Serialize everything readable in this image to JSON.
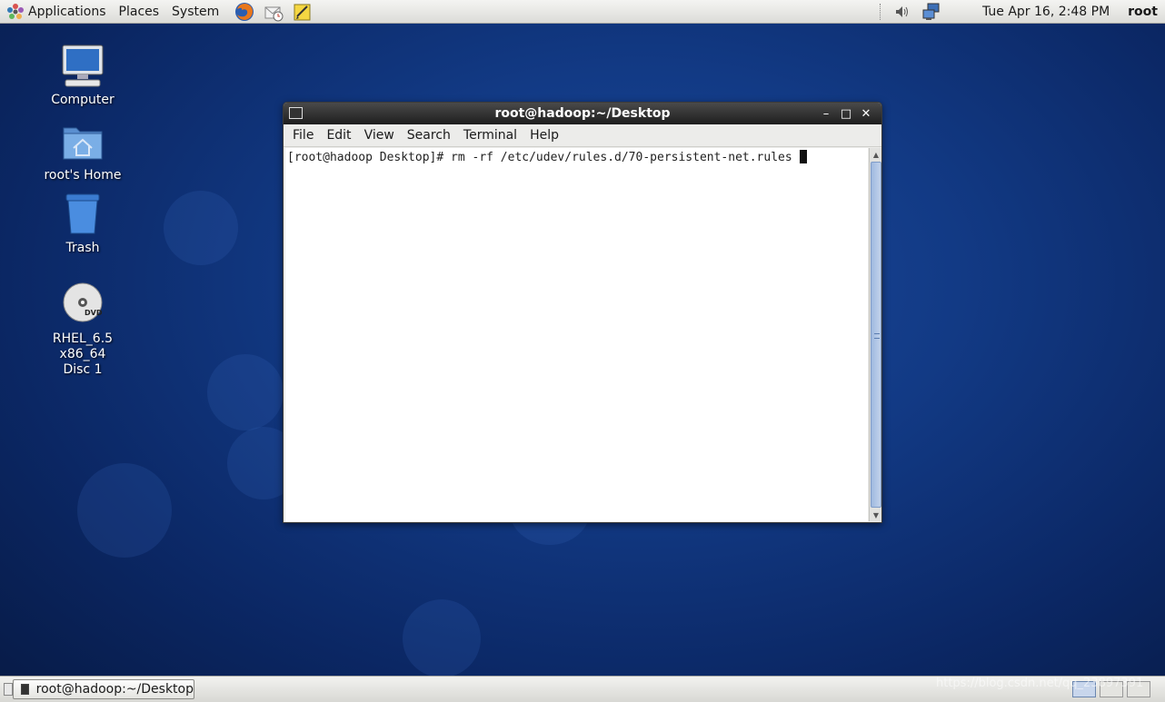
{
  "top_panel": {
    "menus": [
      "Applications",
      "Places",
      "System"
    ],
    "clock": "Tue Apr 16,  2:48 PM",
    "user": "root"
  },
  "desktop": {
    "icons": [
      {
        "label": "Computer"
      },
      {
        "label": "root's Home"
      },
      {
        "label": "Trash"
      },
      {
        "label": "RHEL_6.5 x86_64\nDisc 1"
      }
    ]
  },
  "window": {
    "title": "root@hadoop:~/Desktop",
    "menus": [
      "File",
      "Edit",
      "View",
      "Search",
      "Terminal",
      "Help"
    ],
    "terminal_line": "[root@hadoop Desktop]# rm -rf /etc/udev/rules.d/70-persistent-net.rules",
    "minimize": "–",
    "maximize": "□",
    "close": "✕"
  },
  "bottom_panel": {
    "task_label": "root@hadoop:~/Desktop"
  },
  "watermark": "https://blog.csdn.net/qq_23897391"
}
